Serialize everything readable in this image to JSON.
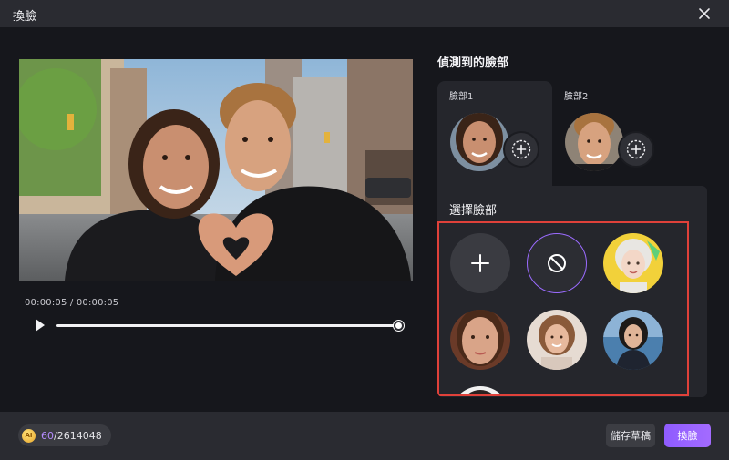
{
  "window": {
    "title": "換臉"
  },
  "player": {
    "current_time": "00:00:05",
    "separator": " / ",
    "total_time": "00:00:05",
    "progress": 1.0
  },
  "detected": {
    "title": "偵測到的臉部",
    "faces": [
      {
        "label": "臉部1",
        "active": true
      },
      {
        "label": "臉部2",
        "active": false
      }
    ]
  },
  "select": {
    "title": "選擇臉部"
  },
  "footer": {
    "credits_used": "60",
    "credits_total": "/2614048",
    "save_label": "儲存草稿",
    "swap_label": "換臉"
  },
  "colors": {
    "accent": "#9b6bff",
    "highlight_border": "#e0413a"
  }
}
